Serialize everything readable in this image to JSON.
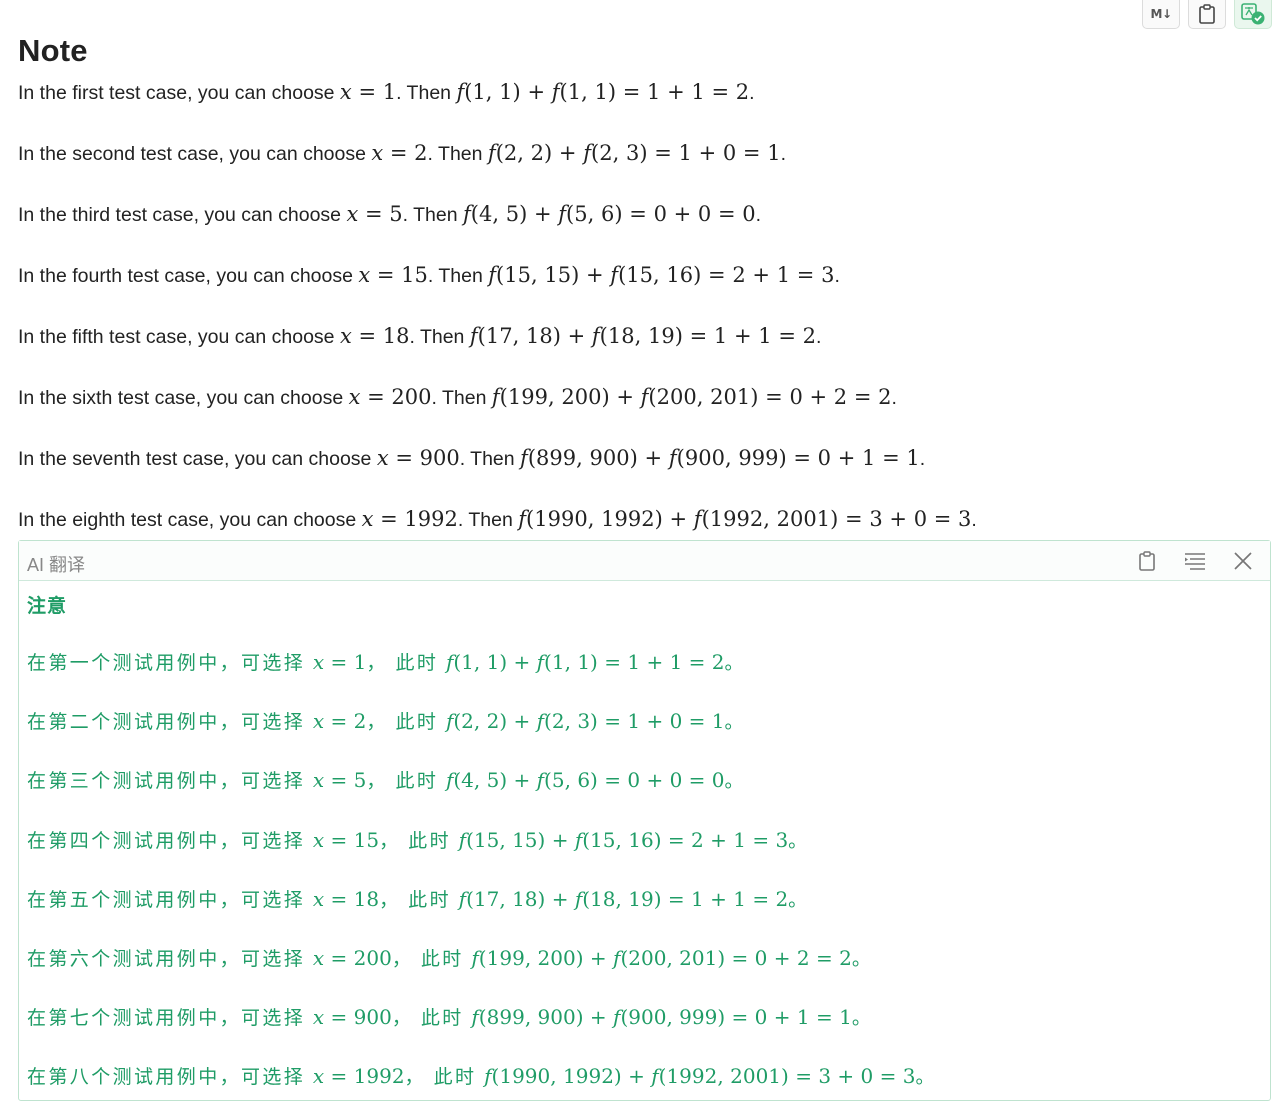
{
  "toolbar": {
    "markdown_label": "M↓",
    "copy_icon": "clipboard-icon",
    "translate_icon": "translate-check-icon",
    "accent": "#3bb273"
  },
  "note": {
    "title": "Note",
    "lines": [
      {
        "a": "In the first test case, you can choose ",
        "x": "x",
        "b": " = 1",
        "c": ". Then ",
        "f": "f(1, 1) + f(1, 1) = 1 + 1 = 2",
        "d": "."
      },
      {
        "a": "In the second test case, you can choose ",
        "x": "x",
        "b": " = 2",
        "c": ". Then ",
        "f": "f(2, 2) + f(2, 3) = 1 + 0 = 1",
        "d": "."
      },
      {
        "a": "In the third test case, you can choose ",
        "x": "x",
        "b": " = 5",
        "c": ". Then ",
        "f": "f(4, 5) + f(5, 6) = 0 + 0 = 0",
        "d": "."
      },
      {
        "a": "In the fourth test case, you can choose ",
        "x": "x",
        "b": " = 15",
        "c": ". Then ",
        "f": "f(15, 15) + f(15, 16) = 2 + 1 = 3",
        "d": "."
      },
      {
        "a": "In the fifth test case, you can choose ",
        "x": "x",
        "b": " = 18",
        "c": ". Then ",
        "f": "f(17, 18) + f(18, 19) = 1 + 1 = 2",
        "d": "."
      },
      {
        "a": "In the sixth test case, you can choose ",
        "x": "x",
        "b": " = 200",
        "c": ". Then ",
        "f": "f(199, 200) + f(200, 201) = 0 + 2 = 2",
        "d": "."
      },
      {
        "a": "In the seventh test case, you can choose ",
        "x": "x",
        "b": " = 900",
        "c": ". Then ",
        "f": "f(899, 900) + f(900, 999) = 0 + 1 = 1",
        "d": "."
      },
      {
        "a": "In the eighth test case, you can choose ",
        "x": "x",
        "b": " = 1992",
        "c": ". Then ",
        "f": "f(1990, 1992) + f(1992, 2001) = 3 + 0 = 3",
        "d": "."
      }
    ]
  },
  "ai_panel": {
    "title": "AI 翻译",
    "heading": "注意",
    "text_color": "#1f9c66",
    "lines": [
      {
        "a": "在第一个测试用例中，可选择 ",
        "x": "x",
        "b": " = 1",
        "c": "， 此时 ",
        "f": "f(1, 1) + f(1, 1) = 1 + 1 = 2",
        "d": "。"
      },
      {
        "a": "在第二个测试用例中，可选择 ",
        "x": "x",
        "b": " = 2",
        "c": "， 此时 ",
        "f": "f(2, 2) + f(2, 3) = 1 + 0 = 1",
        "d": "。"
      },
      {
        "a": "在第三个测试用例中，可选择 ",
        "x": "x",
        "b": " = 5",
        "c": "， 此时 ",
        "f": "f(4, 5) + f(5, 6) = 0 + 0 = 0",
        "d": "。"
      },
      {
        "a": "在第四个测试用例中，可选择 ",
        "x": "x",
        "b": " = 15",
        "c": "， 此时 ",
        "f": "f(15, 15) + f(15, 16) = 2 + 1 = 3",
        "d": "。"
      },
      {
        "a": "在第五个测试用例中，可选择 ",
        "x": "x",
        "b": " = 18",
        "c": "， 此时 ",
        "f": "f(17, 18) + f(18, 19) = 1 + 1 = 2",
        "d": "。"
      },
      {
        "a": "在第六个测试用例中，可选择 ",
        "x": "x",
        "b": " = 200",
        "c": "， 此时 ",
        "f": "f(199, 200) + f(200, 201) = 0 + 2 = 2",
        "d": "。"
      },
      {
        "a": "在第七个测试用例中，可选择 ",
        "x": "x",
        "b": " = 900",
        "c": "， 此时 ",
        "f": "f(899, 900) + f(900, 999) = 0 + 1 = 1",
        "d": "。"
      },
      {
        "a": "在第八个测试用例中，可选择 ",
        "x": "x",
        "b": " = 1992",
        "c": "， 此时 ",
        "f": "f(1990, 1992) + f(1992, 2001) = 3 + 0 = 3",
        "d": "。"
      }
    ],
    "icons": [
      "clipboard-icon",
      "indent-lines-icon",
      "close-icon"
    ]
  }
}
